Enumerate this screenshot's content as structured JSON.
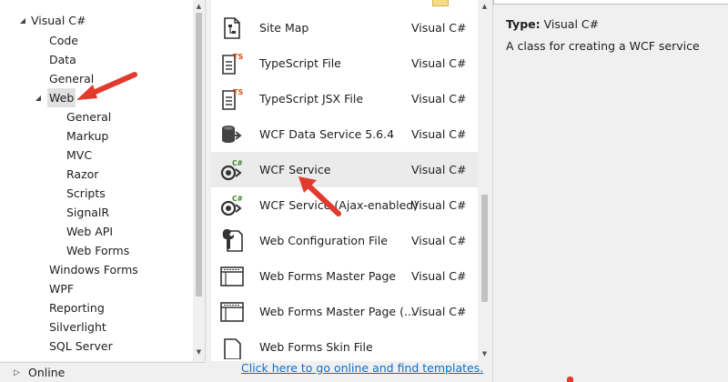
{
  "tree": {
    "items": [
      {
        "label": "Visual C#",
        "expander": "◢"
      },
      {
        "label": "Code"
      },
      {
        "label": "Data"
      },
      {
        "label": "General"
      },
      {
        "label": "Web",
        "expander": "◢"
      },
      {
        "label": "General"
      },
      {
        "label": "Markup"
      },
      {
        "label": "MVC"
      },
      {
        "label": "Razor"
      },
      {
        "label": "Scripts"
      },
      {
        "label": "SignalR"
      },
      {
        "label": "Web API"
      },
      {
        "label": "Web Forms"
      },
      {
        "label": "Windows Forms"
      },
      {
        "label": "WPF"
      },
      {
        "label": "Reporting"
      },
      {
        "label": "Silverlight"
      },
      {
        "label": "SQL Server"
      }
    ],
    "online": {
      "label": "Online",
      "expander": "▷"
    },
    "scroll_up": "▲",
    "scroll_down": "▼"
  },
  "templates": {
    "items": [
      {
        "name": "Site Map",
        "lang": "Visual C#",
        "icon": "sitemap-icon"
      },
      {
        "name": "TypeScript File",
        "lang": "Visual C#",
        "icon": "typescript-file-icon",
        "badge": "TS"
      },
      {
        "name": "TypeScript JSX File",
        "lang": "Visual C#",
        "icon": "typescript-jsx-file-icon",
        "badge": "TS"
      },
      {
        "name": "WCF Data Service 5.6.4",
        "lang": "Visual C#",
        "icon": "data-service-icon"
      },
      {
        "name": "WCF Service",
        "lang": "Visual C#",
        "icon": "wcf-service-icon",
        "badge": "C#"
      },
      {
        "name": "WCF Service (Ajax-enabled)",
        "lang": "Visual C#",
        "icon": "wcf-ajax-service-icon",
        "badge": "C#"
      },
      {
        "name": "Web Configuration File",
        "lang": "Visual C#",
        "icon": "web-config-icon"
      },
      {
        "name": "Web Forms Master Page",
        "lang": "Visual C#",
        "icon": "master-page-icon"
      },
      {
        "name": "Web Forms Master Page (...",
        "lang": "Visual C#",
        "icon": "nested-master-page-icon"
      },
      {
        "name": "Web Forms Skin File",
        "lang": "",
        "icon": "skin-file-icon"
      }
    ],
    "online_link": "Click here to go online and find templates.",
    "scroll_up": "▲",
    "scroll_down": "▼"
  },
  "details": {
    "type_key": "Type:",
    "type_value": "Visual C#",
    "description": "A class for creating a WCF service"
  },
  "colors": {
    "annotation_arrow": "#e23b2e",
    "link": "#0e6ec7",
    "selection": "#ebebeb"
  }
}
